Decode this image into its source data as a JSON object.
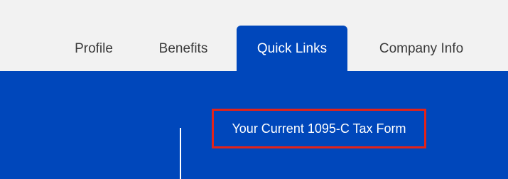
{
  "tabs": [
    {
      "label": "Profile",
      "active": false
    },
    {
      "label": "Benefits",
      "active": false
    },
    {
      "label": "Quick Links",
      "active": true
    },
    {
      "label": "Company Info",
      "active": false
    }
  ],
  "quick_links": {
    "items": [
      {
        "label": "Your Current 1095-C Tax Form",
        "highlighted": true
      }
    ]
  },
  "colors": {
    "page_background": "#f2f2f2",
    "brand_blue": "#0047bb",
    "highlight_border": "#e2231a",
    "tab_text": "#3a3a3a",
    "active_tab_text": "#ffffff"
  }
}
